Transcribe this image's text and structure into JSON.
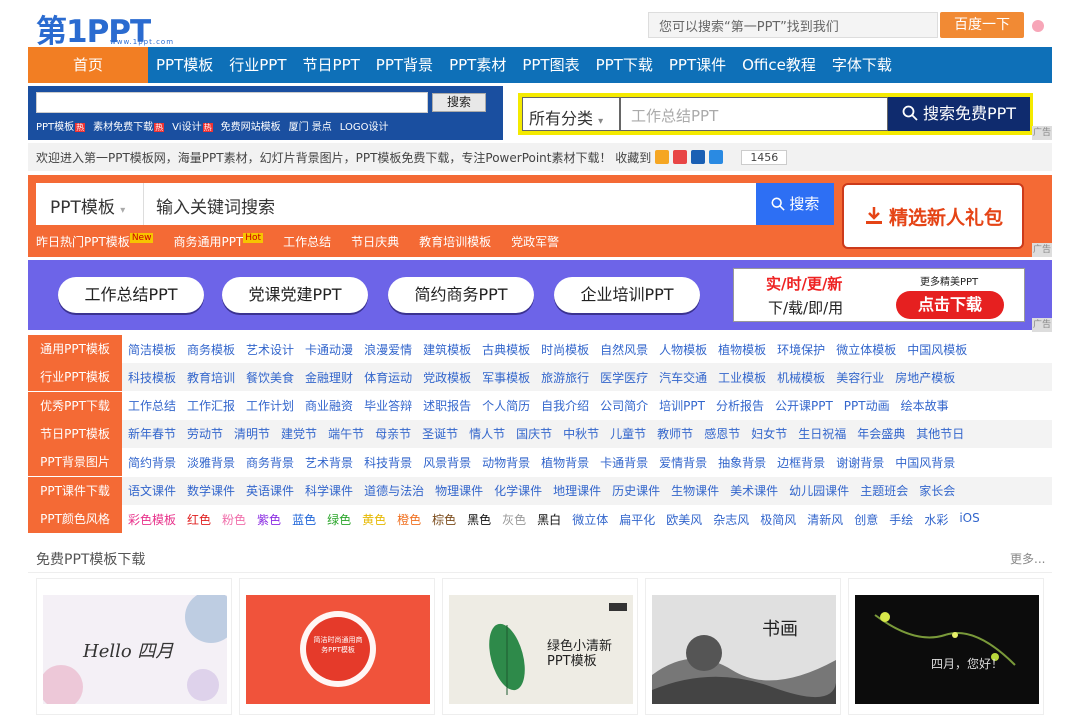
{
  "header": {
    "logo_text": "第1PPT",
    "logo_url": "www.1ppt.com",
    "search_placeholder": "您可以搜索“第一PPT”找到我们",
    "search_button": "百度一下"
  },
  "nav": {
    "home": "首页",
    "items": [
      "PPT模板",
      "行业PPT",
      "节日PPT",
      "PPT背景",
      "PPT素材",
      "PPT图表",
      "PPT下载",
      "PPT课件",
      "Office教程",
      "字体下载"
    ]
  },
  "ad_search_1": {
    "button": "搜索",
    "links": [
      {
        "label": "PPT模板",
        "hot": "热"
      },
      {
        "label": "素材免费下载",
        "hot": "热"
      },
      {
        "label": "Vi设计",
        "hot": "热"
      },
      {
        "label": "免费网站模板",
        "hot": ""
      },
      {
        "label": "厦门 景点",
        "hot": ""
      },
      {
        "label": "LOGO设计",
        "hot": ""
      }
    ]
  },
  "ad_search_2": {
    "category": "所有分类",
    "placeholder": "工作总结PPT",
    "button": "搜索免费PPT",
    "ad_label": "广告"
  },
  "welcome": {
    "text": "欢迎进入第一PPT模板网，海量PPT素材，幻灯片背景图片，PPT模板免费下载，专注PowerPoint素材下载！ 收藏到",
    "count": "1456",
    "social_colors": [
      "#f5a623",
      "#e84545",
      "#1a5fb4",
      "#2a8ae2"
    ]
  },
  "promo_search": {
    "select": "PPT模板",
    "placeholder": "输入关键词搜索",
    "button": "搜索",
    "gift": "精选新人礼包",
    "hot_links": [
      {
        "label": "昨日热门PPT模板",
        "tag": "New"
      },
      {
        "label": "商务通用PPT",
        "tag": "Hot"
      },
      {
        "label": "工作总结",
        "tag": ""
      },
      {
        "label": "节日庆典",
        "tag": ""
      },
      {
        "label": "教育培训模板",
        "tag": ""
      },
      {
        "label": "党政军警",
        "tag": ""
      }
    ],
    "ad_label": "广告"
  },
  "banner": {
    "pills": [
      "工作总结PPT",
      "党课党建PPT",
      "简约商务PPT",
      "企业培训PPT"
    ],
    "promo_line1": "实/时/更/新",
    "promo_line2": "下/载/即/用",
    "promo_more": "更多精美PPT",
    "promo_button": "点击下载",
    "ad_label": "广告"
  },
  "categories": [
    {
      "head": "通用PPT模板",
      "links": [
        "简洁模板",
        "商务模板",
        "艺术设计",
        "卡通动漫",
        "浪漫爱情",
        "建筑模板",
        "古典模板",
        "时尚模板",
        "自然风景",
        "人物模板",
        "植物模板",
        "环境保护",
        "微立体模板",
        "中国风模板"
      ]
    },
    {
      "head": "行业PPT模板",
      "links": [
        "科技模板",
        "教育培训",
        "餐饮美食",
        "金融理财",
        "体育运动",
        "党政模板",
        "军事模板",
        "旅游旅行",
        "医学医疗",
        "汽车交通",
        "工业模板",
        "机械模板",
        "美容行业",
        "房地产模板"
      ]
    },
    {
      "head": "优秀PPT下载",
      "links": [
        "工作总结",
        "工作汇报",
        "工作计划",
        "商业融资",
        "毕业答辩",
        "述职报告",
        "个人简历",
        "自我介绍",
        "公司简介",
        "培训PPT",
        "分析报告",
        "公开课PPT",
        "PPT动画",
        "绘本故事"
      ]
    },
    {
      "head": "节日PPT模板",
      "links": [
        "新年春节",
        "劳动节",
        "清明节",
        "建党节",
        "端午节",
        "母亲节",
        "圣诞节",
        "情人节",
        "国庆节",
        "中秋节",
        "儿童节",
        "教师节",
        "感恩节",
        "妇女节",
        "生日祝福",
        "年会盛典",
        "其他节日"
      ]
    },
    {
      "head": "PPT背景图片",
      "links": [
        "简约背景",
        "淡雅背景",
        "商务背景",
        "艺术背景",
        "科技背景",
        "风景背景",
        "动物背景",
        "植物背景",
        "卡通背景",
        "爱情背景",
        "抽象背景",
        "边框背景",
        "谢谢背景",
        "中国风背景"
      ]
    },
    {
      "head": "PPT课件下载",
      "links": [
        "语文课件",
        "数学课件",
        "英语课件",
        "科学课件",
        "道德与法治",
        "物理课件",
        "化学课件",
        "地理课件",
        "历史课件",
        "生物课件",
        "美术课件",
        "幼儿园课件",
        "主题班会",
        "家长会"
      ]
    }
  ],
  "colors_row": {
    "head": "PPT颜色风格",
    "items": [
      {
        "label": "彩色模板",
        "color": "#e8318a"
      },
      {
        "label": "红色",
        "color": "#e02020"
      },
      {
        "label": "粉色",
        "color": "#f06eaa"
      },
      {
        "label": "紫色",
        "color": "#8a2be2"
      },
      {
        "label": "蓝色",
        "color": "#1e64d8"
      },
      {
        "label": "绿色",
        "color": "#2aa52a"
      },
      {
        "label": "黄色",
        "color": "#e6b800"
      },
      {
        "label": "橙色",
        "color": "#f07020"
      },
      {
        "label": "棕色",
        "color": "#7a4a1a"
      },
      {
        "label": "黑色",
        "color": "#111111"
      },
      {
        "label": "灰色",
        "color": "#999999"
      },
      {
        "label": "黑白",
        "color": "#111111"
      },
      {
        "label": "微立体",
        "color": "#36c"
      },
      {
        "label": "扁平化",
        "color": "#36c"
      },
      {
        "label": "欧美风",
        "color": "#36c"
      },
      {
        "label": "杂志风",
        "color": "#36c"
      },
      {
        "label": "极简风",
        "color": "#36c"
      },
      {
        "label": "清新风",
        "color": "#36c"
      },
      {
        "label": "创意",
        "color": "#36c"
      },
      {
        "label": "手绘",
        "color": "#36c"
      },
      {
        "label": "水彩",
        "color": "#36c"
      },
      {
        "label": "iOS",
        "color": "#36c"
      }
    ]
  },
  "free_section": {
    "title": "免费PPT模板下载",
    "more": "更多...",
    "thumbs": [
      {
        "caption": "Hello 四月",
        "bg": "#f4f0f6"
      },
      {
        "caption": "简洁时尚通用商务PPT模板",
        "bg": "#f0533b"
      },
      {
        "caption": "绿色小清新PPT模板",
        "bg": "#eeece4"
      },
      {
        "caption": "书画",
        "bg": "#e0e0e0"
      },
      {
        "caption": "四月，您好！",
        "bg": "#0c0c0c"
      }
    ]
  }
}
